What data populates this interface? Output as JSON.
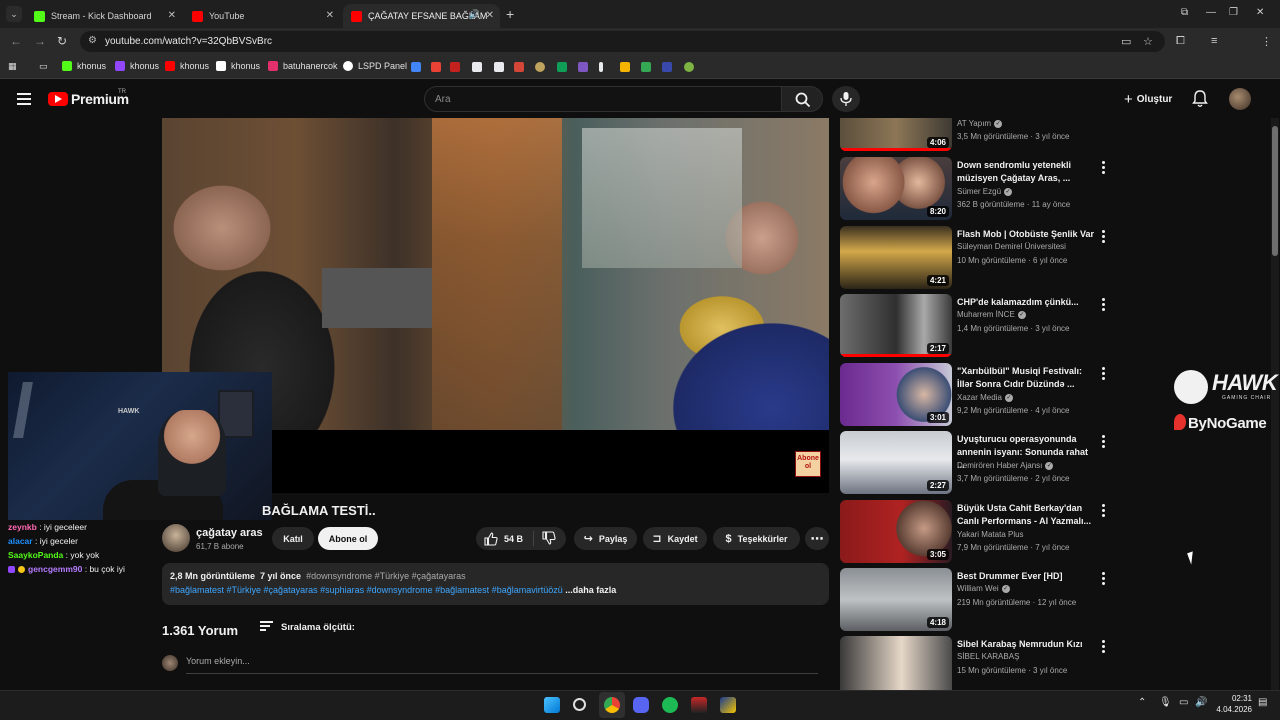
{
  "browser": {
    "tabs": [
      {
        "label": "Stream - Kick Dashboard",
        "color": "#53fc18",
        "active": false
      },
      {
        "label": "YouTube",
        "color": "#ff0000",
        "active": false
      },
      {
        "label": "ÇAĞATAY EFSANE BAĞLAM",
        "color": "#ff0000",
        "active": true
      }
    ],
    "url": "youtube.com/watch?v=32QbBVSvBrc",
    "bookmarks": [
      {
        "label": "khonus",
        "color": "#53fc18"
      },
      {
        "label": "khonus",
        "color": "#9146ff"
      },
      {
        "label": "khonus",
        "color": "#ff0000"
      },
      {
        "label": "khonus",
        "color": "#ffffff"
      },
      {
        "label": "batuhanercok",
        "color": "#e1306c"
      },
      {
        "label": "LSPD Panel",
        "color": "#ffffff"
      }
    ]
  },
  "youtube": {
    "brand": "Premium",
    "region": "TR",
    "search_placeholder": "Ara",
    "create_label": "Oluştur",
    "video": {
      "title": "BAĞLAMA TESTİ..",
      "channel": "çağatay aras",
      "subscribers": "61,7 B abone",
      "join_label": "Katıl",
      "subscribe_label": "Abone ol",
      "likes": "54 B",
      "share_label": "Paylaş",
      "save_label": "Kaydet",
      "thanks_label": "Teşekkürler",
      "badge_text": "Abone ol",
      "views": "2,8 Mn görüntüleme",
      "age": "7 yıl önce",
      "tags_line1": "#downsyndrome #Türkiye #çağatayaras",
      "tags_line2": "#bağlamatest #Türkiye #çağatayaras #suphiaras #downsyndrome #bağlamatest #bağlamavirtüözü",
      "more_label": "...daha fazla"
    },
    "comments": {
      "count": "1.361 Yorum",
      "sort_label": "Sıralama ölçütü:",
      "placeholder": "Yorum ekleyin..."
    },
    "recommendations": [
      {
        "title": "",
        "channel": "AT Yapım",
        "verified": true,
        "meta": "3,5 Mn görüntüleme · 3 yıl önce",
        "duration": "4:06",
        "progress": 1.0
      },
      {
        "title": "Down sendromlu yetenekli müzisyen Çağatay Aras, ...",
        "channel": "Sümer Ezgü",
        "verified": true,
        "meta": "362 B görüntüleme · 11 ay önce",
        "duration": "8:20",
        "progress": 0
      },
      {
        "title": "Flash Mob | Otobüste Şenlik Var",
        "channel": "Süleyman Demirel Üniversitesi",
        "verified": false,
        "meta": "10 Mn görüntüleme · 6 yıl önce",
        "duration": "4:21",
        "progress": 0
      },
      {
        "title": "CHP'de kalamazdım çünkü...",
        "channel": "Muharrem İNCE",
        "verified": true,
        "meta": "1,4 Mn görüntüleme · 3 yıl önce",
        "duration": "2:17",
        "progress": 1.0
      },
      {
        "title": "\"Xarıbülbül\" Musiqi Festivalı: İllər Sonra Cıdır Düzündə ...",
        "channel": "Xazar Media",
        "verified": true,
        "meta": "9,2 Mn görüntüleme · 4 yıl önce",
        "duration": "3:01",
        "progress": 0
      },
      {
        "title": "Uyuşturucu operasyonunda annenin isyanı: Sonunda rahat ...",
        "channel": "Demirören Haber Ajansı",
        "verified": true,
        "meta": "3,7 Mn görüntüleme · 2 yıl önce",
        "duration": "2:27",
        "progress": 0
      },
      {
        "title": "Büyük Usta Cahit Berkay'dan Canlı Performans - Al Yazmalı...",
        "channel": "Yakari Matata Plus",
        "verified": false,
        "meta": "7,9 Mn görüntüleme · 7 yıl önce",
        "duration": "3:05",
        "progress": 0
      },
      {
        "title": "Best Drummer Ever [HD]",
        "channel": "William Wei",
        "verified": true,
        "meta": "219 Mn görüntüleme · 12 yıl önce",
        "duration": "4:18",
        "progress": 0
      },
      {
        "title": "Sibel Karabaş Nemrudun Kızı",
        "channel": "SİBEL KARABAŞ",
        "verified": false,
        "meta": "15 Mn görüntüleme · 3 yıl önce",
        "duration": "",
        "progress": 0
      }
    ]
  },
  "stream_overlay": {
    "sponsor1": "HAWK",
    "sponsor1_sub": "GAMING CHAIR",
    "sponsor2": "ByNoGame",
    "chat": [
      {
        "user": "zeynkb",
        "color": "#ff69b4",
        "message": "iyi geceleer"
      },
      {
        "user": "alacar",
        "color": "#1e90ff",
        "message": "iyi geceler"
      },
      {
        "user": "SaaykoPanda",
        "color": "#53fc18",
        "message": "yok yok"
      },
      {
        "user": "gencgemm90",
        "color": "#b57cff",
        "message": "bu çok iyi"
      }
    ]
  },
  "taskbar": {
    "time": "02:31",
    "date": "4.04.2026"
  }
}
